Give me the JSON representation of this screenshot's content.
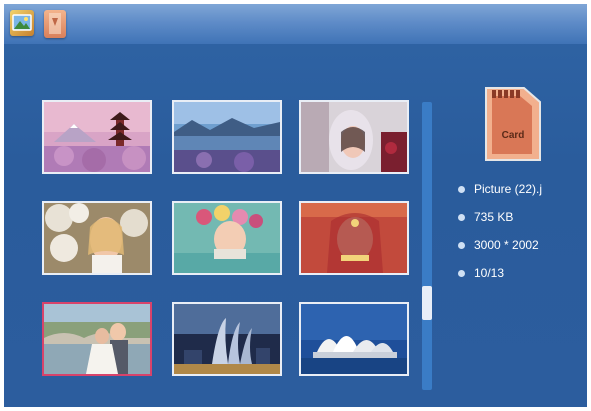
{
  "topbar": {
    "icons": [
      {
        "name": "gallery-icon"
      },
      {
        "name": "memory-card-icon"
      }
    ]
  },
  "storage": {
    "card_label": "Card"
  },
  "thumbnails": [
    {
      "name": "pagoda-mountain",
      "selected": false
    },
    {
      "name": "lake-landscape",
      "selected": false
    },
    {
      "name": "woman-veil",
      "selected": false
    },
    {
      "name": "bride-blossoms",
      "selected": false
    },
    {
      "name": "woman-flowers",
      "selected": false
    },
    {
      "name": "indian-bride",
      "selected": false
    },
    {
      "name": "wedding-couple",
      "selected": true
    },
    {
      "name": "city-towers-night",
      "selected": false
    },
    {
      "name": "sydney-opera-house",
      "selected": false
    }
  ],
  "file_info": {
    "filename": "Picture  (22).j",
    "size": "735 KB",
    "resolution": "3000 * 2002",
    "position": "10/13"
  },
  "scrollbar": {
    "position_fraction": 0.64
  }
}
